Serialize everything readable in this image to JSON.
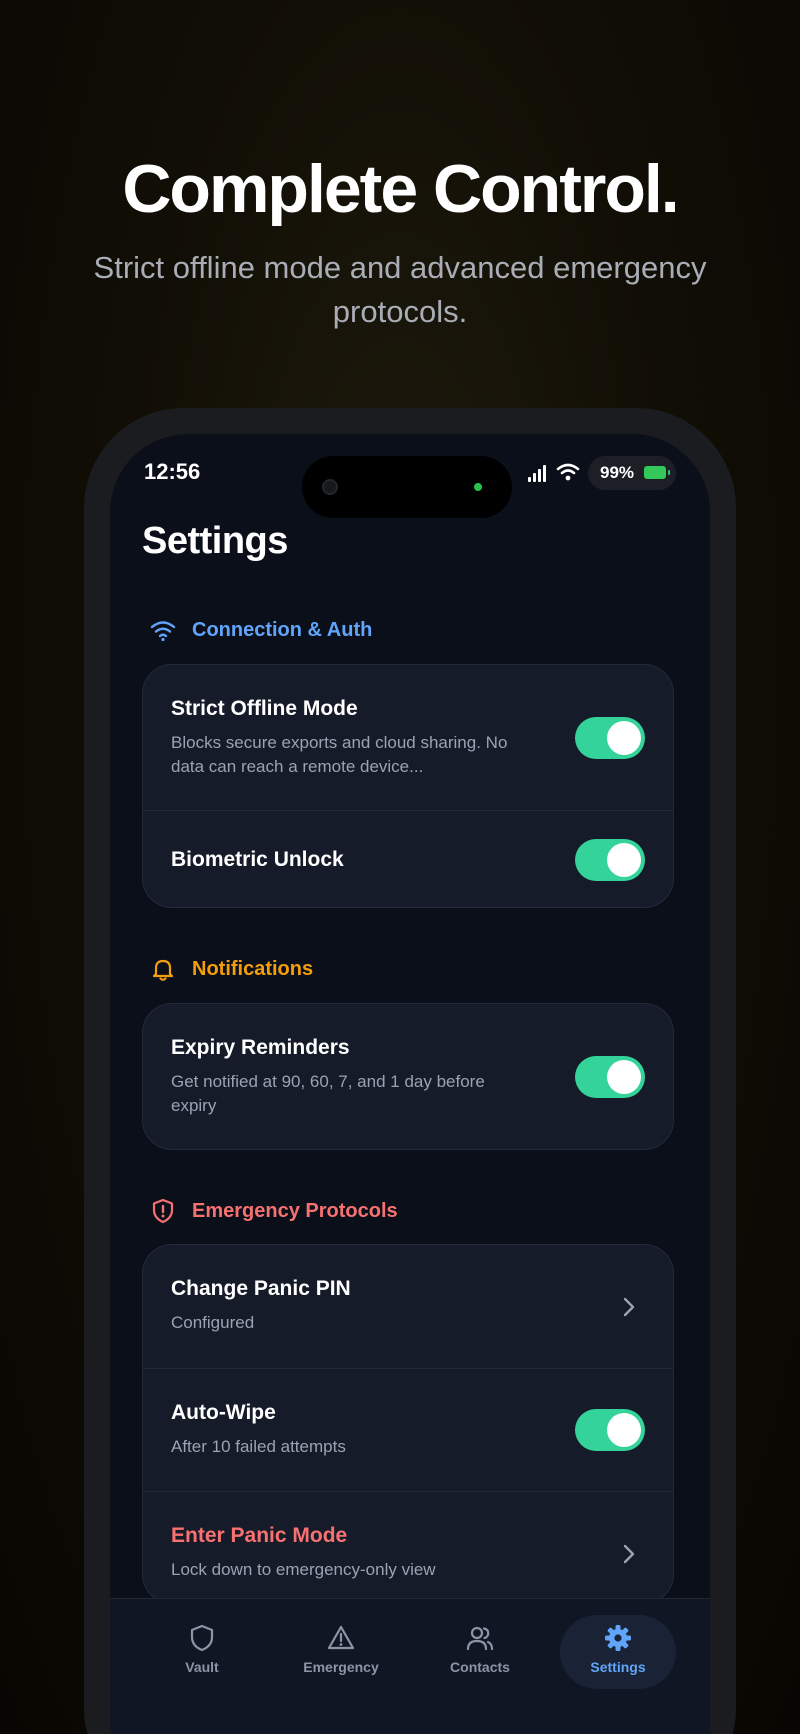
{
  "hero": {
    "title": "Complete Control.",
    "subtitle": "Strict offline mode and advanced emergency protocols."
  },
  "status_bar": {
    "time": "12:56",
    "battery": "99%"
  },
  "page_title": "Settings",
  "sections": [
    {
      "label": "Connection & Auth",
      "icon": "wifi-icon",
      "color": "#60a5fa",
      "rows": [
        {
          "title": "Strict Offline Mode",
          "subtitle": "Blocks secure exports and cloud sharing. No data can reach a remote device...",
          "toggle": true
        },
        {
          "title": "Biometric Unlock",
          "toggle": true
        }
      ]
    },
    {
      "label": "Notifications",
      "icon": "bell-icon",
      "color": "#f59e0b",
      "rows": [
        {
          "title": "Expiry Reminders",
          "subtitle": "Get notified at 90, 60, 7, and 1 day before expiry",
          "toggle": true
        }
      ]
    },
    {
      "label": "Emergency Protocols",
      "icon": "shield-alert-icon",
      "color": "#f87171",
      "rows": [
        {
          "title": "Change Panic PIN",
          "subtitle": "Configured",
          "chevron": true
        },
        {
          "title": "Auto-Wipe",
          "subtitle": "After 10 failed attempts",
          "toggle": true
        },
        {
          "title": "Enter Panic Mode",
          "subtitle": "Lock down to emergency-only view",
          "chevron": true,
          "title_color": "#f87171"
        }
      ]
    }
  ],
  "tabs": [
    {
      "label": "Vault",
      "icon": "shield-icon",
      "active": false
    },
    {
      "label": "Emergency",
      "icon": "warning-icon",
      "active": false
    },
    {
      "label": "Contacts",
      "icon": "users-icon",
      "active": false
    },
    {
      "label": "Settings",
      "icon": "gear-icon",
      "active": true
    }
  ],
  "colors": {
    "toggle_on": "#34d399",
    "accent_blue": "#60a5fa",
    "accent_orange": "#f59e0b",
    "accent_red": "#f87171"
  }
}
